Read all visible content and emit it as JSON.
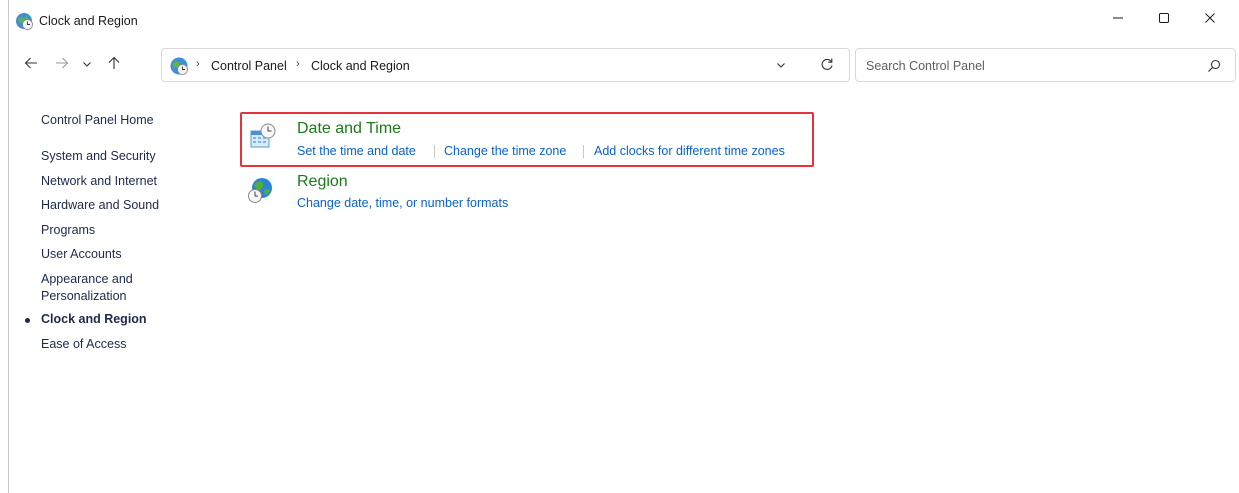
{
  "window": {
    "title": "Clock and Region",
    "title_icon": "clock-globe-icon"
  },
  "caption_buttons": {
    "minimize_icon": "minimize-icon",
    "maximize_icon": "maximize-icon",
    "close_icon": "close-icon"
  },
  "navigation": {
    "back_icon": "arrow-left-icon",
    "forward_icon": "arrow-right-icon",
    "recent_icon": "chevron-down-icon",
    "up_icon": "arrow-up-icon"
  },
  "address": {
    "icon": "control-panel-icon",
    "crumbs": [
      "Control Panel",
      "Clock and Region"
    ],
    "separator": "›",
    "dropdown_icon": "chevron-down-icon",
    "refresh_icon": "refresh-icon"
  },
  "search": {
    "placeholder": "Search Control Panel",
    "value": "",
    "icon": "search-icon"
  },
  "sidebar": {
    "items": [
      {
        "label": "Control Panel Home",
        "current": false
      },
      {
        "label": "System and Security",
        "current": false
      },
      {
        "label": "Network and Internet",
        "current": false
      },
      {
        "label": "Hardware and Sound",
        "current": false
      },
      {
        "label": "Programs",
        "current": false
      },
      {
        "label": "User Accounts",
        "current": false
      },
      {
        "label": "Appearance and Personalization",
        "current": false
      },
      {
        "label": "Clock and Region",
        "current": true
      },
      {
        "label": "Ease of Access",
        "current": false
      }
    ],
    "appearance_line1": "Appearance and",
    "appearance_line2": "Personalization"
  },
  "categories": [
    {
      "title": "Date and Time",
      "icon": "date-time-icon",
      "links": [
        "Set the time and date",
        "Change the time zone",
        "Add clocks for different time zones"
      ],
      "highlighted": true
    },
    {
      "title": "Region",
      "icon": "region-globe-icon",
      "links": [
        "Change date, time, or number formats"
      ],
      "highlighted": false
    }
  ],
  "colors": {
    "category_title": "#1a7a1a",
    "link": "#0b62c4",
    "highlight_border": "#e5323b",
    "nav_text": "#1c2b4a"
  }
}
